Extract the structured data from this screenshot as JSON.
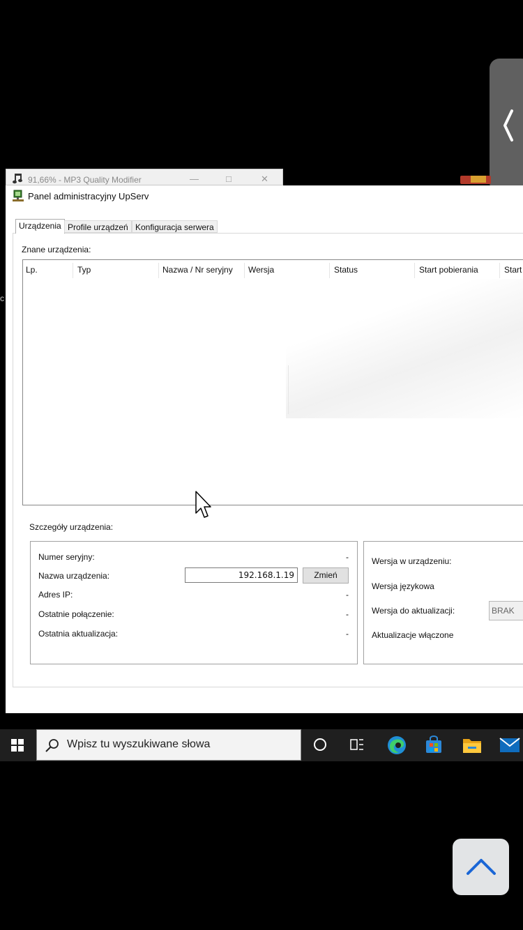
{
  "background_window": {
    "title": "91,66% - MP3 Quality Modifier",
    "minimize": "—",
    "maximize": "□",
    "close": "✕"
  },
  "left_edge_char": "c",
  "main_window": {
    "title": "Panel administracyjny UpServ",
    "tabs": [
      {
        "label": "Urządzenia",
        "active": true
      },
      {
        "label": "Profile urządzeń",
        "active": false
      },
      {
        "label": "Konfiguracja serwera",
        "active": false
      }
    ],
    "known_devices_label": "Znane urządzenia:",
    "device_table": {
      "columns": [
        "Lp.",
        "Typ",
        "Nazwa / Nr seryjny",
        "Wersja",
        "Status",
        "Start pobierania",
        "Start"
      ],
      "rows": []
    },
    "details": {
      "label": "Szczegóły urządzenia:",
      "serial_label": "Numer seryjny:",
      "serial_value": "-",
      "name_label": "Nazwa urządzenia:",
      "name_value": "192.168.1.19",
      "change_button": "Zmień",
      "ip_label": "Adres IP:",
      "ip_value": "-",
      "last_conn_label": "Ostatnie połączenie:",
      "last_conn_value": "-",
      "last_update_label": "Ostatnia aktualizacja:",
      "last_update_value": "-"
    },
    "version_panel": {
      "device_version_label": "Wersja w urządzeniu:",
      "language_version_label": "Wersja językowa",
      "update_version_label": "Wersja do aktualizacji:",
      "update_version_value": "BRAK",
      "updates_enabled_label": "Aktualizacje włączone"
    }
  },
  "taskbar": {
    "search_placeholder": "Wpisz tu wyszukiwane słowa",
    "icons": [
      "windows-icon",
      "search-icon",
      "cortana-icon",
      "task-view-icon",
      "edge-icon",
      "store-icon",
      "file-explorer-icon",
      "mail-icon"
    ]
  },
  "overlay": {
    "side_tab_icon": "chevron-left-icon",
    "scroll_top_icon": "chevron-up-icon"
  },
  "colors": {
    "taskbar": "#1f1f1f",
    "overlay_tab": "#606060",
    "scroll_button": "#e2e4e6"
  }
}
